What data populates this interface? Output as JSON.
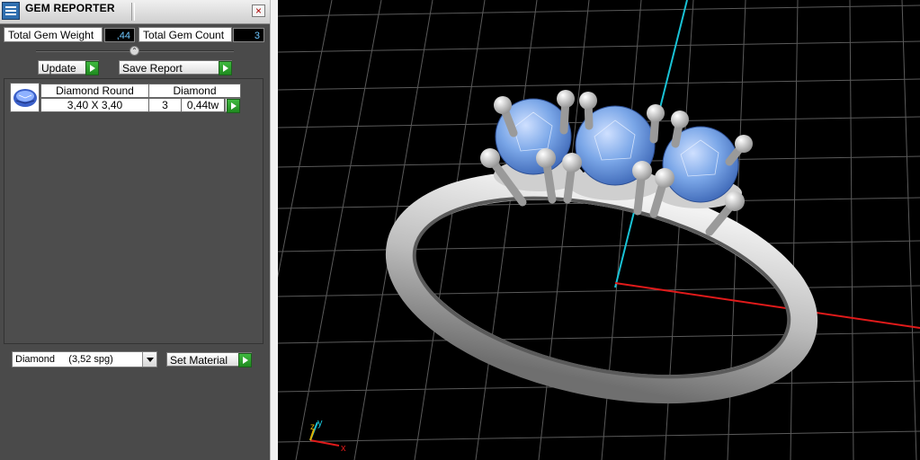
{
  "window": {
    "title": "GEM REPORTER",
    "close_label": "×"
  },
  "totals": {
    "weight_label": "Total Gem Weight",
    "weight_value": ",44",
    "count_label": "Total Gem Count",
    "count_value": "3"
  },
  "actions": {
    "update_label": "Update",
    "save_label": "Save Report"
  },
  "gem_list": {
    "rows": [
      {
        "name": "Diamond Round",
        "material": "Diamond",
        "size": "3,40 X 3,40",
        "count": "3",
        "weight": "0,44tw"
      }
    ]
  },
  "material": {
    "selected": "Diamond     (3,52 spg)",
    "set_label": "Set Material"
  },
  "viewport": {
    "axis_labels": {
      "x": "x",
      "y": "y",
      "z": "z"
    },
    "colors": {
      "grid": "#5a5a5a",
      "x_axis": "#e01a1a",
      "y_axis": "#19c2d6",
      "gem": "#7ba7e8",
      "metal": "#d9d9d9"
    }
  }
}
